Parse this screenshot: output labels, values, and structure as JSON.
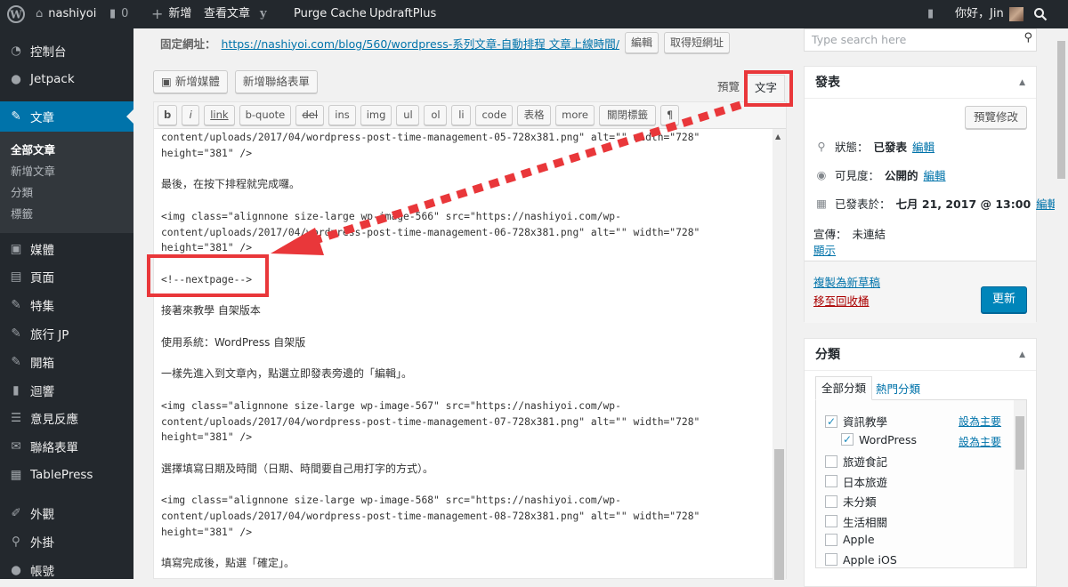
{
  "adminbar": {
    "site_name": "nashiyoi",
    "comments_count": "0",
    "new_label": "新增",
    "view_post_label": "查看文章",
    "purge_cache_label": "Purge Cache",
    "updraft_label": "UpdraftPlus",
    "greeting": "你好，Jin"
  },
  "sidebar": {
    "items": [
      {
        "label": "控制台",
        "icon": "dashboard-icon"
      },
      {
        "label": "Jetpack",
        "icon": "jetpack-icon"
      },
      {
        "label": "文章",
        "icon": "pin-icon"
      },
      {
        "label": "媒體",
        "icon": "media-icon"
      },
      {
        "label": "頁面",
        "icon": "page-icon"
      },
      {
        "label": "特集",
        "icon": "pin-icon"
      },
      {
        "label": "旅行 JP",
        "icon": "pin-icon"
      },
      {
        "label": "開箱",
        "icon": "pin-icon"
      },
      {
        "label": "迴響",
        "icon": "comment-icon"
      },
      {
        "label": "意見反應",
        "icon": "feedback-icon"
      },
      {
        "label": "聯絡表單",
        "icon": "mail-icon"
      },
      {
        "label": "TablePress",
        "icon": "table-icon"
      },
      {
        "label": "外觀",
        "icon": "appearance-icon"
      },
      {
        "label": "外掛",
        "icon": "plugin-icon"
      },
      {
        "label": "帳號",
        "icon": "user-icon"
      }
    ],
    "submenu": [
      "全部文章",
      "新增文章",
      "分類",
      "標籤"
    ]
  },
  "permalink": {
    "label": "固定網址：",
    "url": "https://nashiyoi.com/blog/560/wordpress-系列文章-自動排程 文章上線時間/",
    "edit_label": "編輯",
    "shortlink_label": "取得短網址"
  },
  "toolbar": {
    "add_media": "新增媒體",
    "add_contact_form": "新增聯絡表單",
    "tab_visual": "預覽",
    "tab_text": "文字",
    "quicktags": [
      "b",
      "i",
      "link",
      "b-quote",
      "del",
      "ins",
      "img",
      "ul",
      "ol",
      "li",
      "code",
      "表格",
      "more",
      "關閉標籤",
      "¶"
    ]
  },
  "editor": {
    "lines": [
      {
        "text": "content/uploads/2017/04/wordpress-post-time-management-05-728x381.png\" alt=\"\" width=\"728\"",
        "prose": false
      },
      {
        "text": "height=\"381\" />",
        "prose": false
      },
      {
        "text": "",
        "prose": false
      },
      {
        "text": "最後，在按下排程就完成囉。",
        "prose": true
      },
      {
        "text": "",
        "prose": false
      },
      {
        "text": "<img class=\"alignnone size-large wp-image-566\" src=\"https://nashiyoi.com/wp-",
        "prose": false
      },
      {
        "text": "content/uploads/2017/04/wordpress-post-time-management-06-728x381.png\" alt=\"\" width=\"728\"",
        "prose": false
      },
      {
        "text": "height=\"381\" />",
        "prose": false
      },
      {
        "text": "",
        "prose": false
      },
      {
        "text": "<!--nextpage-->",
        "prose": false
      },
      {
        "text": "",
        "prose": false
      },
      {
        "text": "接著來教學 自架版本",
        "prose": true
      },
      {
        "text": "",
        "prose": false
      },
      {
        "text": "使用系統：WordPress 自架版",
        "prose": true
      },
      {
        "text": "",
        "prose": false
      },
      {
        "text": "一樣先進入到文章內，點選立即發表旁邊的「編輯」。",
        "prose": true
      },
      {
        "text": "",
        "prose": false
      },
      {
        "text": "<img class=\"alignnone size-large wp-image-567\" src=\"https://nashiyoi.com/wp-",
        "prose": false
      },
      {
        "text": "content/uploads/2017/04/wordpress-post-time-management-07-728x381.png\" alt=\"\" width=\"728\"",
        "prose": false
      },
      {
        "text": "height=\"381\" />",
        "prose": false
      },
      {
        "text": "",
        "prose": false
      },
      {
        "text": "選擇填寫日期及時間（日期、時間要自己用打字的方式）。",
        "prose": true
      },
      {
        "text": "",
        "prose": false
      },
      {
        "text": "<img class=\"alignnone size-large wp-image-568\" src=\"https://nashiyoi.com/wp-",
        "prose": false
      },
      {
        "text": "content/uploads/2017/04/wordpress-post-time-management-08-728x381.png\" alt=\"\" width=\"728\"",
        "prose": false
      },
      {
        "text": "height=\"381\" />",
        "prose": false
      },
      {
        "text": "",
        "prose": false
      },
      {
        "text": "填寫完成後，點選「確定」。",
        "prose": true
      }
    ]
  },
  "search": {
    "placeholder": "Type search here"
  },
  "publish": {
    "title": "發表",
    "preview_changes": "預覽修改",
    "status_label": "狀態：",
    "status_value": "已發表",
    "visibility_label": "可見度：",
    "visibility_value": "公開的",
    "published_label": "已發表於：",
    "published_value": "七月 21, 2017 @ 13:00",
    "edit_link": "編輯",
    "promote_label": "宣傳：",
    "promote_value": "未連結",
    "show_link": "顯示",
    "copy_draft": "複製為新草稿",
    "trash": "移至回收桶",
    "update": "更新"
  },
  "categories": {
    "title": "分類",
    "tab_all": "全部分類",
    "tab_popular": "熱門分類",
    "set_primary": "設為主要",
    "items": [
      {
        "label": "資訊教學",
        "checked": true,
        "child": false
      },
      {
        "label": "WordPress",
        "checked": true,
        "child": true
      },
      {
        "label": "旅遊食記",
        "checked": false,
        "child": false
      },
      {
        "label": "日本旅遊",
        "checked": false,
        "child": false
      },
      {
        "label": "未分類",
        "checked": false,
        "child": false
      },
      {
        "label": "生活相關",
        "checked": false,
        "child": false
      },
      {
        "label": "Apple",
        "checked": false,
        "child": false
      },
      {
        "label": "Apple iOS",
        "checked": false,
        "child": false
      }
    ]
  },
  "colors": {
    "accent": "#0073aa",
    "primary_button": "#0085ba",
    "annotation_red": "#e9373a",
    "adminbar": "#23282d"
  }
}
